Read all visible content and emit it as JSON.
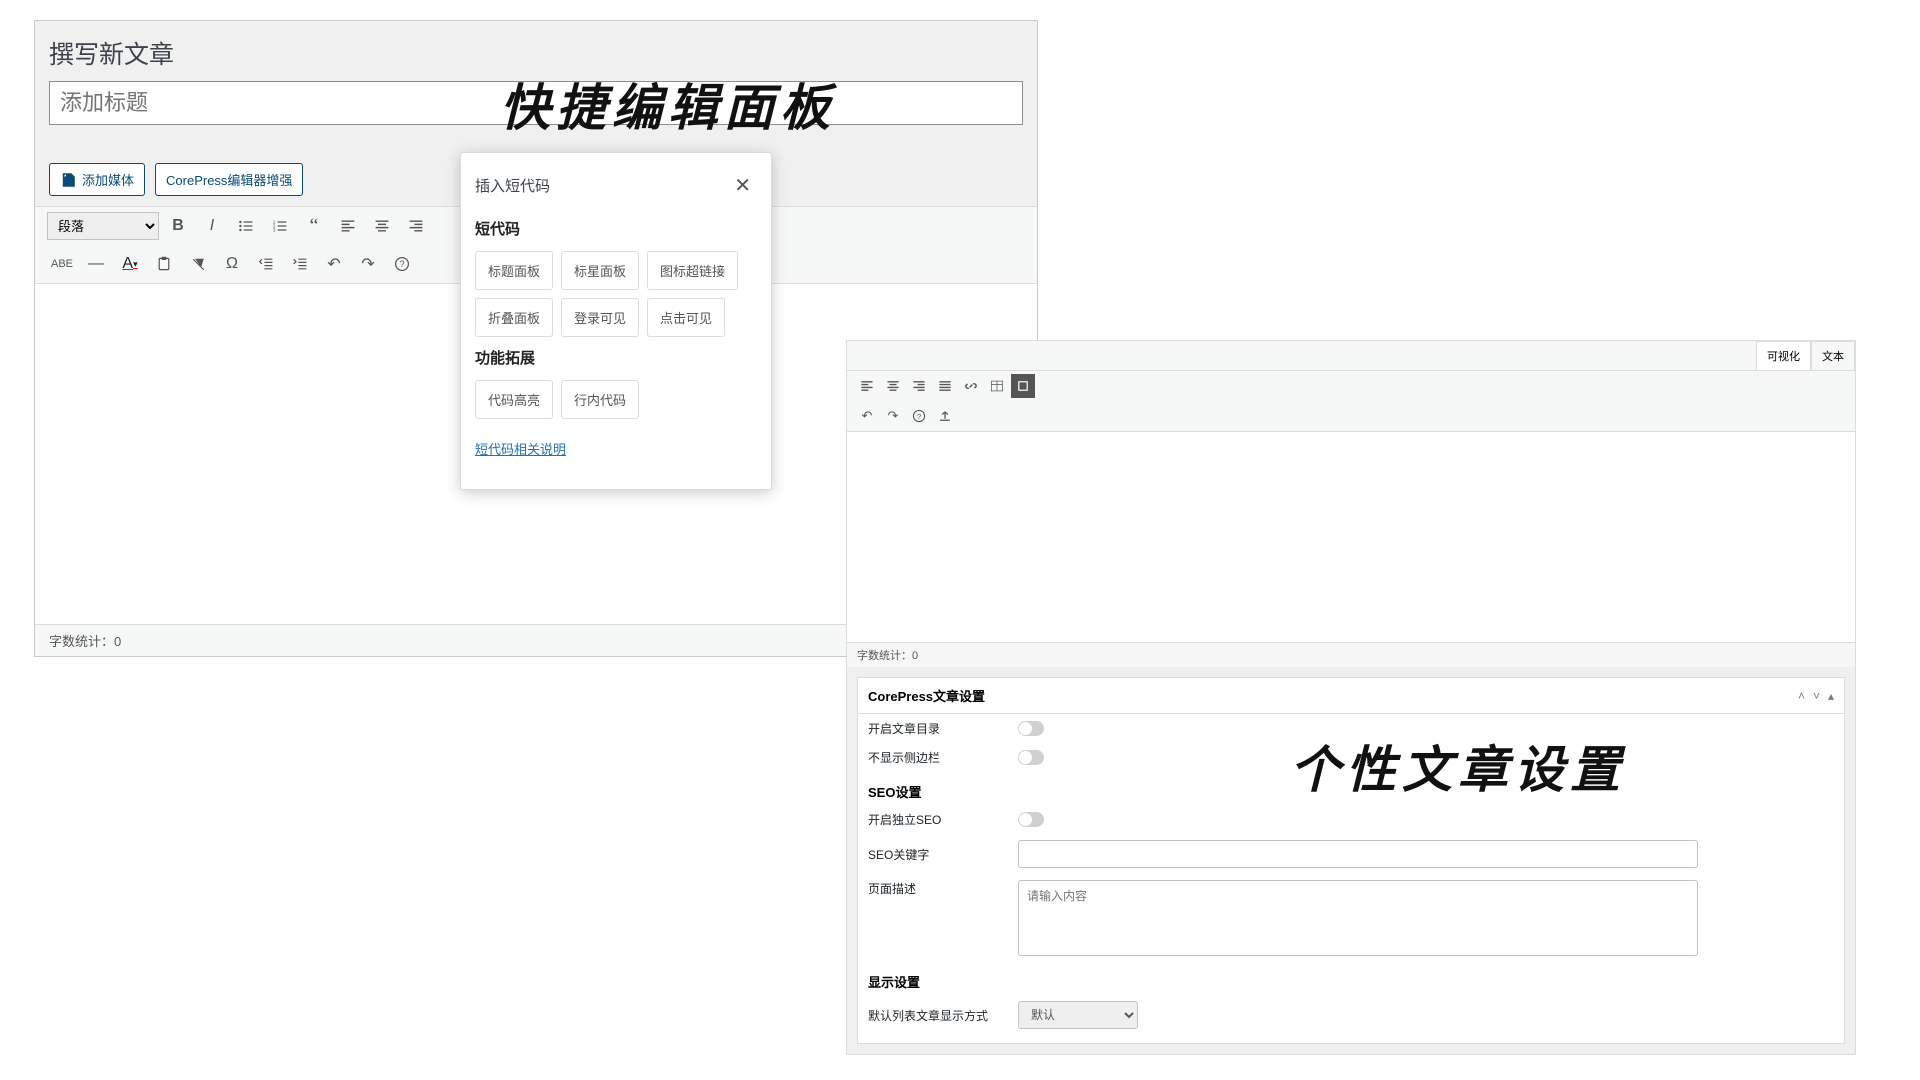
{
  "annotations": {
    "quick_panel": "快捷编辑面板",
    "article_settings": "个性文章设置"
  },
  "panel1": {
    "page_title": "撰写新文章",
    "title_placeholder": "添加标题",
    "btn_media": "添加媒体",
    "btn_enhance": "CorePress编辑器增强",
    "format_select": "段落",
    "wordcount": "字数统计：0"
  },
  "popup": {
    "title": "插入短代码",
    "heading1": "短代码",
    "btns": [
      "标题面板",
      "标星面板",
      "图标超链接",
      "折叠面板",
      "登录可见",
      "点击可见"
    ],
    "heading2": "功能拓展",
    "btns2": [
      "代码高亮",
      "行内代码"
    ],
    "doc_link": "短代码相关说明"
  },
  "panel2": {
    "tabs": {
      "visual": "可视化",
      "text": "文本"
    },
    "wordcount": "字数统计：0",
    "meta_title": "CorePress文章设置",
    "toggles": {
      "toc": "开启文章目录",
      "no_sidebar": "不显示侧边栏",
      "seo": "开启独立SEO"
    },
    "sections": {
      "seo": "SEO设置",
      "display": "显示设置"
    },
    "fields": {
      "seo_kw": "SEO关键字",
      "page_desc": "页面描述",
      "desc_placeholder": "请输入内容",
      "list_mode": "默认列表文章显示方式",
      "select_default": "默认"
    }
  }
}
